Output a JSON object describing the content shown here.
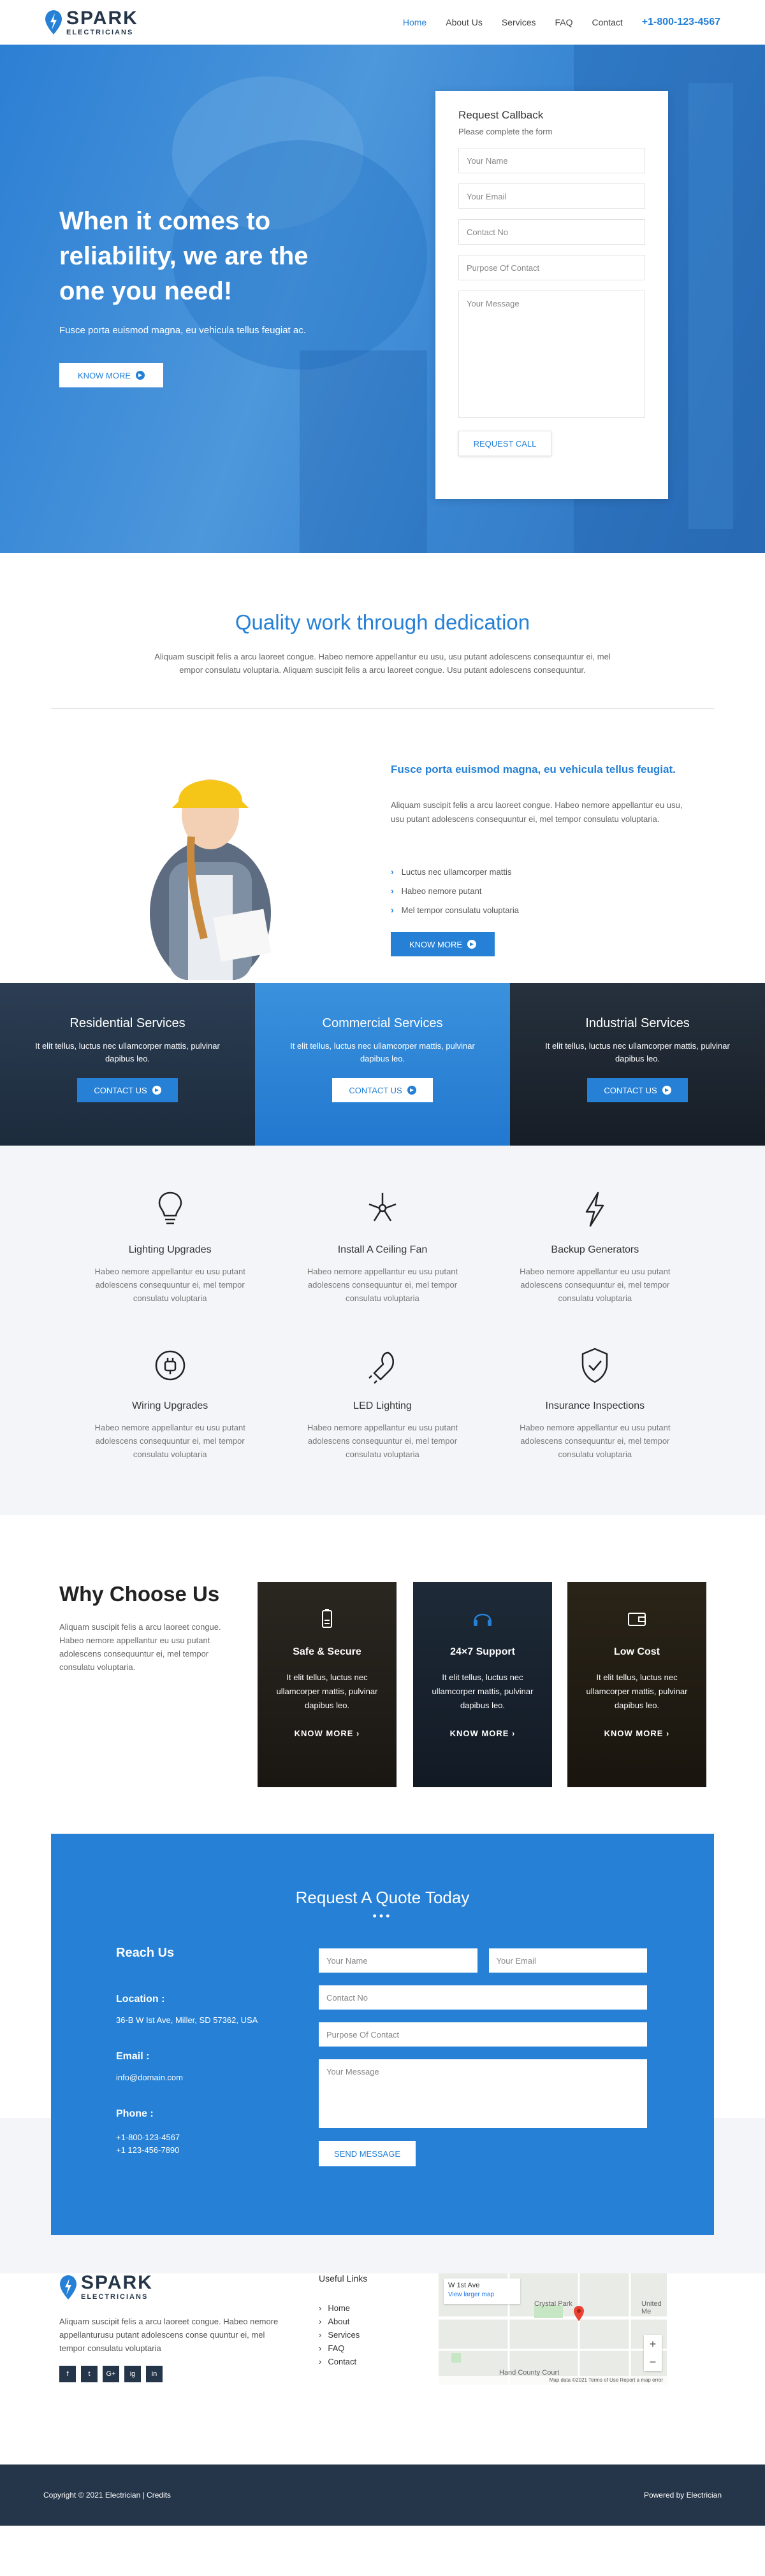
{
  "brand": {
    "name": "SPARK",
    "sub": "ELECTRICIANS"
  },
  "nav": {
    "items": [
      "Home",
      "About Us",
      "Services",
      "FAQ",
      "Contact"
    ],
    "phone": "+1-800-123-4567"
  },
  "hero": {
    "title": "When it comes to reliability, we are the one you need!",
    "subtitle": "Fusce porta euismod magna, eu vehicula tellus feugiat ac.",
    "button": "KNOW MORE"
  },
  "callback": {
    "title": "Request Callback",
    "subtitle": "Please complete the form",
    "fields": [
      "Your Name",
      "Your Email",
      "Contact No",
      "Purpose Of Contact",
      "Your Message"
    ],
    "button": "REQUEST CALL"
  },
  "quality": {
    "title": "Quality work through dedication",
    "text": "Aliquam suscipit felis a arcu laoreet congue. Habeo nemore appellantur eu usu, usu putant adolescens consequuntur ei, mel empor consulatu voluptaria. Aliquam suscipit felis a arcu laoreet congue. Usu putant adolescens consequuntur."
  },
  "feature": {
    "title": "Fusce porta euismod magna, eu vehicula tellus feugiat.",
    "text": "Aliquam suscipit felis a arcu laoreet congue. Habeo nemore appellantur eu usu, usu putant adolescens consequuntur ei, mel tempor consulatu voluptaria.",
    "list": [
      "Luctus nec ullamcorper mattis",
      "Habeo nemore putant",
      "Mel tempor consulatu voluptaria"
    ],
    "button": "KNOW MORE"
  },
  "services": [
    {
      "title": "Residential Services",
      "text": "It elit tellus, luctus nec ullamcorper mattis, pulvinar dapibus leo.",
      "button": "CONTACT US"
    },
    {
      "title": "Commercial Services",
      "text": "It elit tellus, luctus nec ullamcorper mattis, pulvinar dapibus leo.",
      "button": "CONTACT US"
    },
    {
      "title": "Industrial Services",
      "text": "It elit tellus, luctus nec ullamcorper mattis, pulvinar dapibus leo.",
      "button": "CONTACT US"
    }
  ],
  "grid": [
    {
      "icon": "lightbulb-icon",
      "title": "Lighting Upgrades",
      "text": "Habeo nemore appellantur eu usu putant adolescens consequuntur ei, mel tempor consulatu voluptaria"
    },
    {
      "icon": "ceiling-fan-icon",
      "title": "Install A Ceiling Fan",
      "text": "Habeo nemore appellantur eu usu putant adolescens consequuntur ei, mel tempor consulatu voluptaria"
    },
    {
      "icon": "lightning-bolt-icon",
      "title": "Backup Generators",
      "text": "Habeo nemore appellantur eu usu putant adolescens consequuntur ei, mel tempor consulatu voluptaria"
    },
    {
      "icon": "plug-icon",
      "title": "Wiring Upgrades",
      "text": "Habeo nemore appellantur eu usu putant adolescens consequuntur ei, mel tempor consulatu voluptaria"
    },
    {
      "icon": "led-bulb-icon",
      "title": "LED Lighting",
      "text": "Habeo nemore appellantur eu usu putant adolescens consequuntur ei, mel tempor consulatu voluptaria"
    },
    {
      "icon": "shield-check-icon",
      "title": "Insurance Inspections",
      "text": "Habeo nemore appellantur eu usu putant adolescens consequuntur ei, mel tempor consulatu voluptaria"
    }
  ],
  "why": {
    "title": "Why Choose Us",
    "text": "Aliquam suscipit felis a arcu laoreet congue. Habeo nemore appellantur eu usu putant adolescens consequuntur ei, mel tempor consulatu voluptaria.",
    "cards": [
      {
        "icon": "battery-icon",
        "title": "Safe & Secure",
        "text": "It elit tellus, luctus nec ullamcorper mattis, pulvinar dapibus leo.",
        "button": "KNOW MORE"
      },
      {
        "icon": "headset-icon",
        "title": "24×7 Support",
        "text": "It elit tellus, luctus nec ullamcorper mattis, pulvinar dapibus leo.",
        "button": "KNOW MORE"
      },
      {
        "icon": "wallet-icon",
        "title": "Low Cost",
        "text": "It elit tellus, luctus nec ullamcorper mattis, pulvinar dapibus leo.",
        "button": "KNOW MORE"
      }
    ]
  },
  "quote": {
    "title": "Request A Quote Today",
    "reach": "Reach Us",
    "location_label": "Location :",
    "location": "36-B W Ist Ave, Miller, SD 57362, USA",
    "email_label": "Email :",
    "email": "info@domain.com",
    "phone_label": "Phone :",
    "phone1": "+1-800-123-4567",
    "phone2": "+1 123-456-7890",
    "fields": {
      "name": "Your Name",
      "email": "Your Email",
      "contact": "Contact No",
      "purpose": "Purpose Of Contact",
      "message": "Your Message"
    },
    "button": "SEND MESSAGE"
  },
  "footer": {
    "text": "Aliquam suscipit felis a arcu laoreet congue. Habeo nemore appellanturusu putant adolescens conse quuntur ei, mel tempor consulatu voluptaria",
    "social": [
      "f",
      "t",
      "G+",
      "ig",
      "in"
    ],
    "links_title": "Useful Links",
    "links": [
      "Home",
      "About",
      "Services",
      "FAQ",
      "Contact"
    ],
    "map": {
      "place": "W 1st Ave",
      "link": "View larger map",
      "labels": [
        "Crystal Park",
        "Hand County Court",
        "United Me"
      ],
      "footer": "Map data ©2021   Terms of Use   Report a map error"
    }
  },
  "copyright": {
    "left": "Copyright © 2021 Electrician | Credits",
    "right": "Powered by Electrician"
  }
}
